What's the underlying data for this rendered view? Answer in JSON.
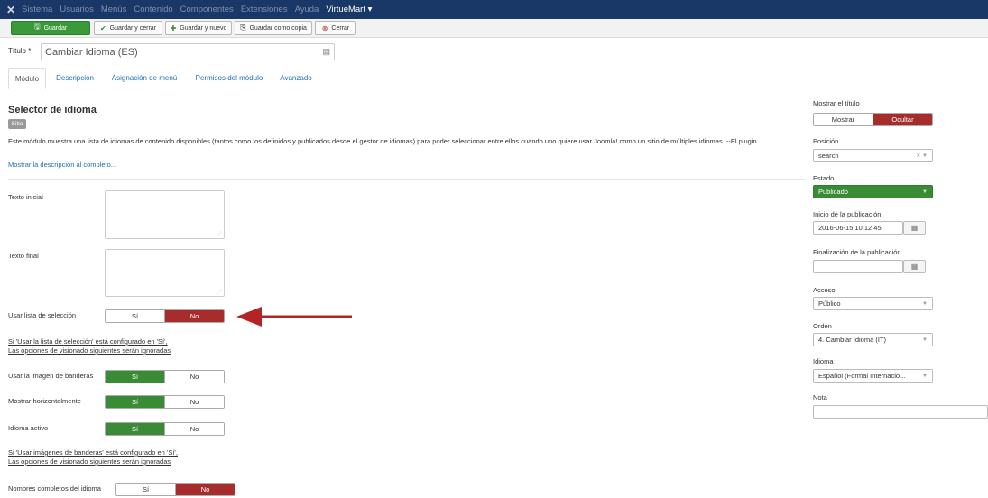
{
  "menubar": {
    "logo": "✕",
    "items": [
      "Sistema",
      "Usuarios",
      "Menús",
      "Contenido",
      "Componentes",
      "Extensiones",
      "Ayuda"
    ],
    "virtuemart": "VirtueMart ▾"
  },
  "toolbar": {
    "save": "Guardar",
    "save_close": "Guardar y cerrar",
    "save_new": "Guardar y nuevo",
    "save_copy": "Guardar como copia",
    "close": "Cerrar"
  },
  "title": {
    "label": "Título *",
    "value": "Cambiar Idioma (ES)"
  },
  "tabs": [
    "Módulo",
    "Descripción",
    "Asignación de menú",
    "Permisos del módulo",
    "Avanzado"
  ],
  "module": {
    "heading": "Selector de idioma",
    "badge": "Sitio",
    "description": "Este módulo muestra una lista de idiomas de contenido disponibles (tantos como los definidos y publicados desde el gestor de idiomas) para poder seleccionar entre ellos cuando uno quiere usar Joomla! como un sitio de múltiples idiomas. --El plugin…",
    "more_link": "Mostrar la descripción al completo..."
  },
  "fields": {
    "texto_inicial": "Texto inicial",
    "texto_final": "Texto final",
    "usar_lista": {
      "label": "Usar lista de selección",
      "yes": "Sí",
      "no": "No",
      "selected": "No"
    },
    "note1_line1": "Si 'Usar la lista de selección' está configurado en 'Sí',",
    "note1_line2": "Las opciones de visionado siguientes serán ignoradas",
    "usar_imagen": {
      "label": "Usar la imagen de banderas",
      "yes": "Sí",
      "no": "No",
      "selected": "Sí"
    },
    "mostrar_horiz": {
      "label": "Mostrar horizontalmente",
      "yes": "Sí",
      "no": "No",
      "selected": "Sí"
    },
    "idioma_activo": {
      "label": "Idioma activo",
      "yes": "Sí",
      "no": "No",
      "selected": "Sí"
    },
    "note2_line1": "Si 'Usar imágenes de banderas' está configurado en 'Sí',",
    "note2_line2": "Las opciones de visionado siguientes serán ignoradas",
    "nombres": {
      "label": "Nombres completos del idioma",
      "yes": "Sí",
      "no": "No",
      "selected": "No"
    }
  },
  "sidebar": {
    "mostrar_titulo": {
      "label": "Mostrar el título",
      "show": "Mostrar",
      "hide": "Ocultar",
      "selected": "Ocultar"
    },
    "posicion": {
      "label": "Posición",
      "value": "search"
    },
    "estado": {
      "label": "Estado",
      "value": "Publicado"
    },
    "inicio": {
      "label": "Inicio de la publicación",
      "value": "2016-06-15 10:12:45"
    },
    "finalizacion": {
      "label": "Finalización de la publicación",
      "value": ""
    },
    "acceso": {
      "label": "Acceso",
      "value": "Público"
    },
    "orden": {
      "label": "Orden",
      "value": "4. Cambiar Idioma (IT)"
    },
    "idioma": {
      "label": "Idioma",
      "value": "Español (Formal Internacio..."
    },
    "nota": {
      "label": "Nota",
      "value": ""
    }
  },
  "colors": {
    "menubar": "#1a3867",
    "green": "#3a8b35",
    "red": "#a72d2d",
    "link": "#1f6fb5"
  }
}
